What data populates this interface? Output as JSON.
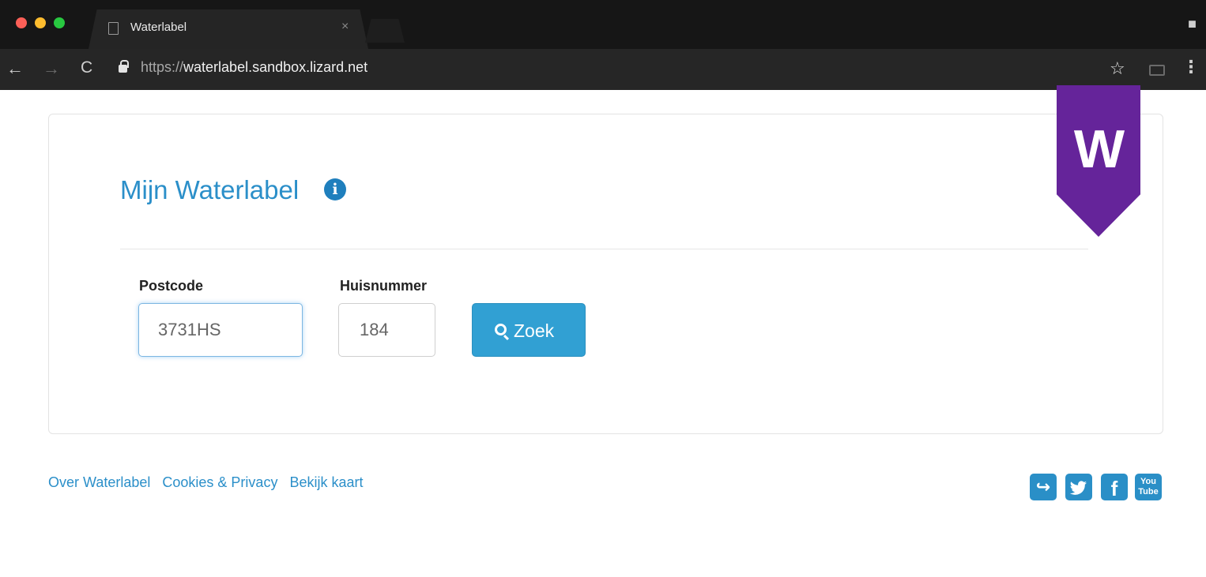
{
  "browser": {
    "tab_title": "Waterlabel",
    "tab_close": "×",
    "url_protocol": "https://",
    "url_host": "waterlabel.sandbox.lizard.net",
    "back_glyph": "←",
    "forward_glyph": "→",
    "reload_glyph": "C",
    "star_glyph": "☆",
    "menu_glyph": "⋮",
    "icons": [
      "page-icon",
      "close-icon",
      "incognito-icon",
      "back-icon",
      "forward-icon",
      "reload-icon",
      "lock-icon",
      "star-icon",
      "cast-icon",
      "menu-icon"
    ]
  },
  "page": {
    "title": "Mijn Waterlabel",
    "info_glyph": "i",
    "logo_letter": "W",
    "logo_color": "#65249a",
    "accent_color": "#2b8fc9",
    "form": {
      "postcode_label": "Postcode",
      "postcode_value": "3731HS",
      "huisnummer_label": "Huisnummer",
      "huisnummer_value": "184",
      "search_button_label": "Zoek"
    },
    "footer": {
      "links": [
        "Over Waterlabel",
        "Cookies & Privacy",
        "Bekijk kaart"
      ],
      "social_icons": [
        "share-icon",
        "twitter-icon",
        "facebook-icon",
        "youtube-icon"
      ],
      "share_glyph": "↪",
      "twitter_glyph": "t",
      "facebook_glyph": "f",
      "youtube_glyph_top": "You",
      "youtube_glyph_bottom": "Tube"
    }
  }
}
